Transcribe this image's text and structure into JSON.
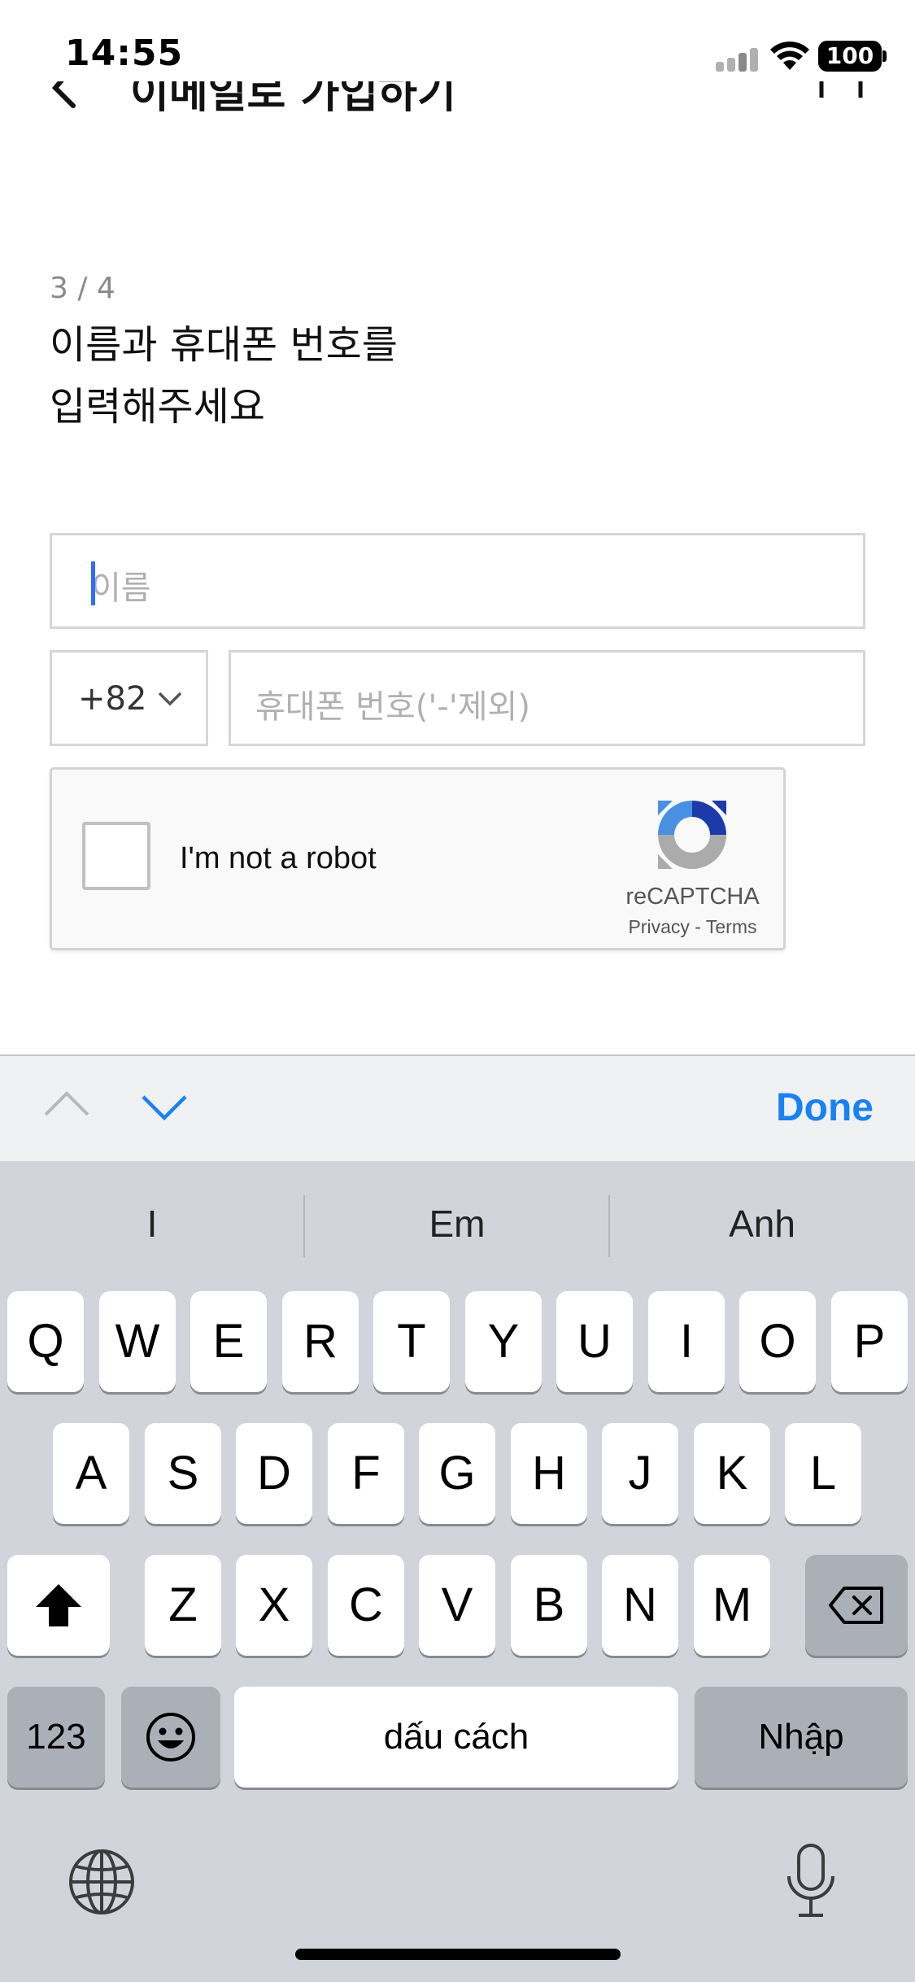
{
  "status_bar": {
    "time": "14:55",
    "battery": "100"
  },
  "header": {
    "title": "이메일로 가입하기"
  },
  "form": {
    "step": "3 / 4",
    "heading_line1": "이름과 휴대폰 번호를",
    "heading_line2": "입력해주세요",
    "name_placeholder": "이름",
    "country_code": "+82",
    "phone_placeholder": "휴대폰 번호('-'제외)"
  },
  "recaptcha": {
    "label": "I'm not a robot",
    "brand": "reCAPTCHA",
    "links": "Privacy - Terms"
  },
  "accessory": {
    "done_label": "Done"
  },
  "keyboard": {
    "suggestions": [
      "I",
      "Em",
      "Anh"
    ],
    "row1": [
      "Q",
      "W",
      "E",
      "R",
      "T",
      "Y",
      "U",
      "I",
      "O",
      "P"
    ],
    "row2": [
      "A",
      "S",
      "D",
      "F",
      "G",
      "H",
      "J",
      "K",
      "L"
    ],
    "row3": [
      "Z",
      "X",
      "C",
      "V",
      "B",
      "N",
      "M"
    ],
    "numbers_key": "123",
    "space_key": "dấu cách",
    "return_key": "Nhập"
  },
  "colors": {
    "accent": "#1a82f0",
    "caret": "#2f6bff",
    "keyboard_bg": "#d1d4db"
  }
}
